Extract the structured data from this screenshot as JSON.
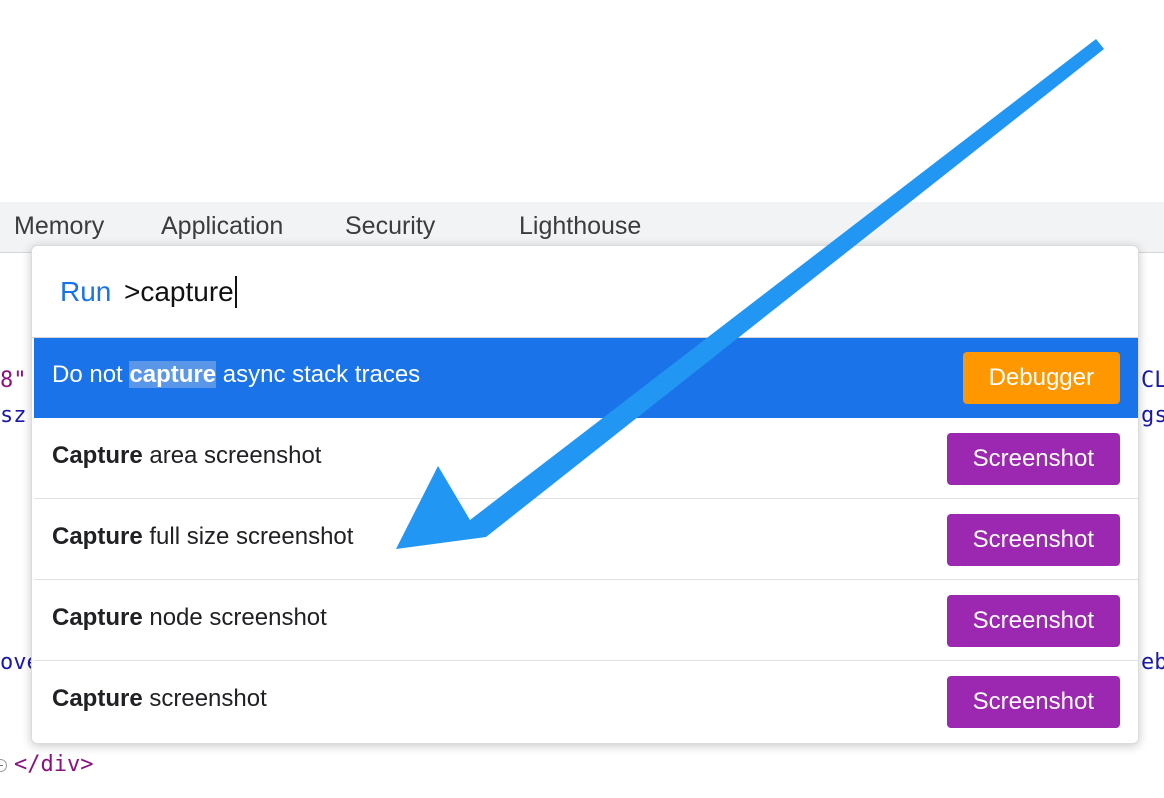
{
  "tabs": [
    "Memory",
    "Application",
    "Security",
    "Lighthouse"
  ],
  "background_code": {
    "left_line1": "8\"",
    "left_line2": "sz",
    "right_line1": "CL",
    "right_line2": "gs",
    "left_line3": "ove",
    "right_line3": "eb",
    "closing_tag": "</div>"
  },
  "command_menu": {
    "prefix": "Run",
    "query": ">capture",
    "results": [
      {
        "before": "Do not ",
        "match": "capture",
        "after": " async stack traces",
        "badge": "Debugger",
        "badge_color": "#ff9800",
        "selected": true
      },
      {
        "before": "",
        "match": "Capture",
        "after": " area screenshot",
        "badge": "Screenshot",
        "badge_color": "#9c27b0",
        "selected": false
      },
      {
        "before": "",
        "match": "Capture",
        "after": " full size screenshot",
        "badge": "Screenshot",
        "badge_color": "#9c27b0",
        "selected": false
      },
      {
        "before": "",
        "match": "Capture",
        "after": " node screenshot",
        "badge": "Screenshot",
        "badge_color": "#9c27b0",
        "selected": false
      },
      {
        "before": "",
        "match": "Capture",
        "after": " screenshot",
        "badge": "Screenshot",
        "badge_color": "#9c27b0",
        "selected": false
      }
    ]
  },
  "colors": {
    "accent": "#1a73e8",
    "arrow": "#2196f3",
    "code_text": "#1a1aa6",
    "code_tag": "#881280"
  },
  "annotation": {
    "icon": "arrow-icon"
  }
}
